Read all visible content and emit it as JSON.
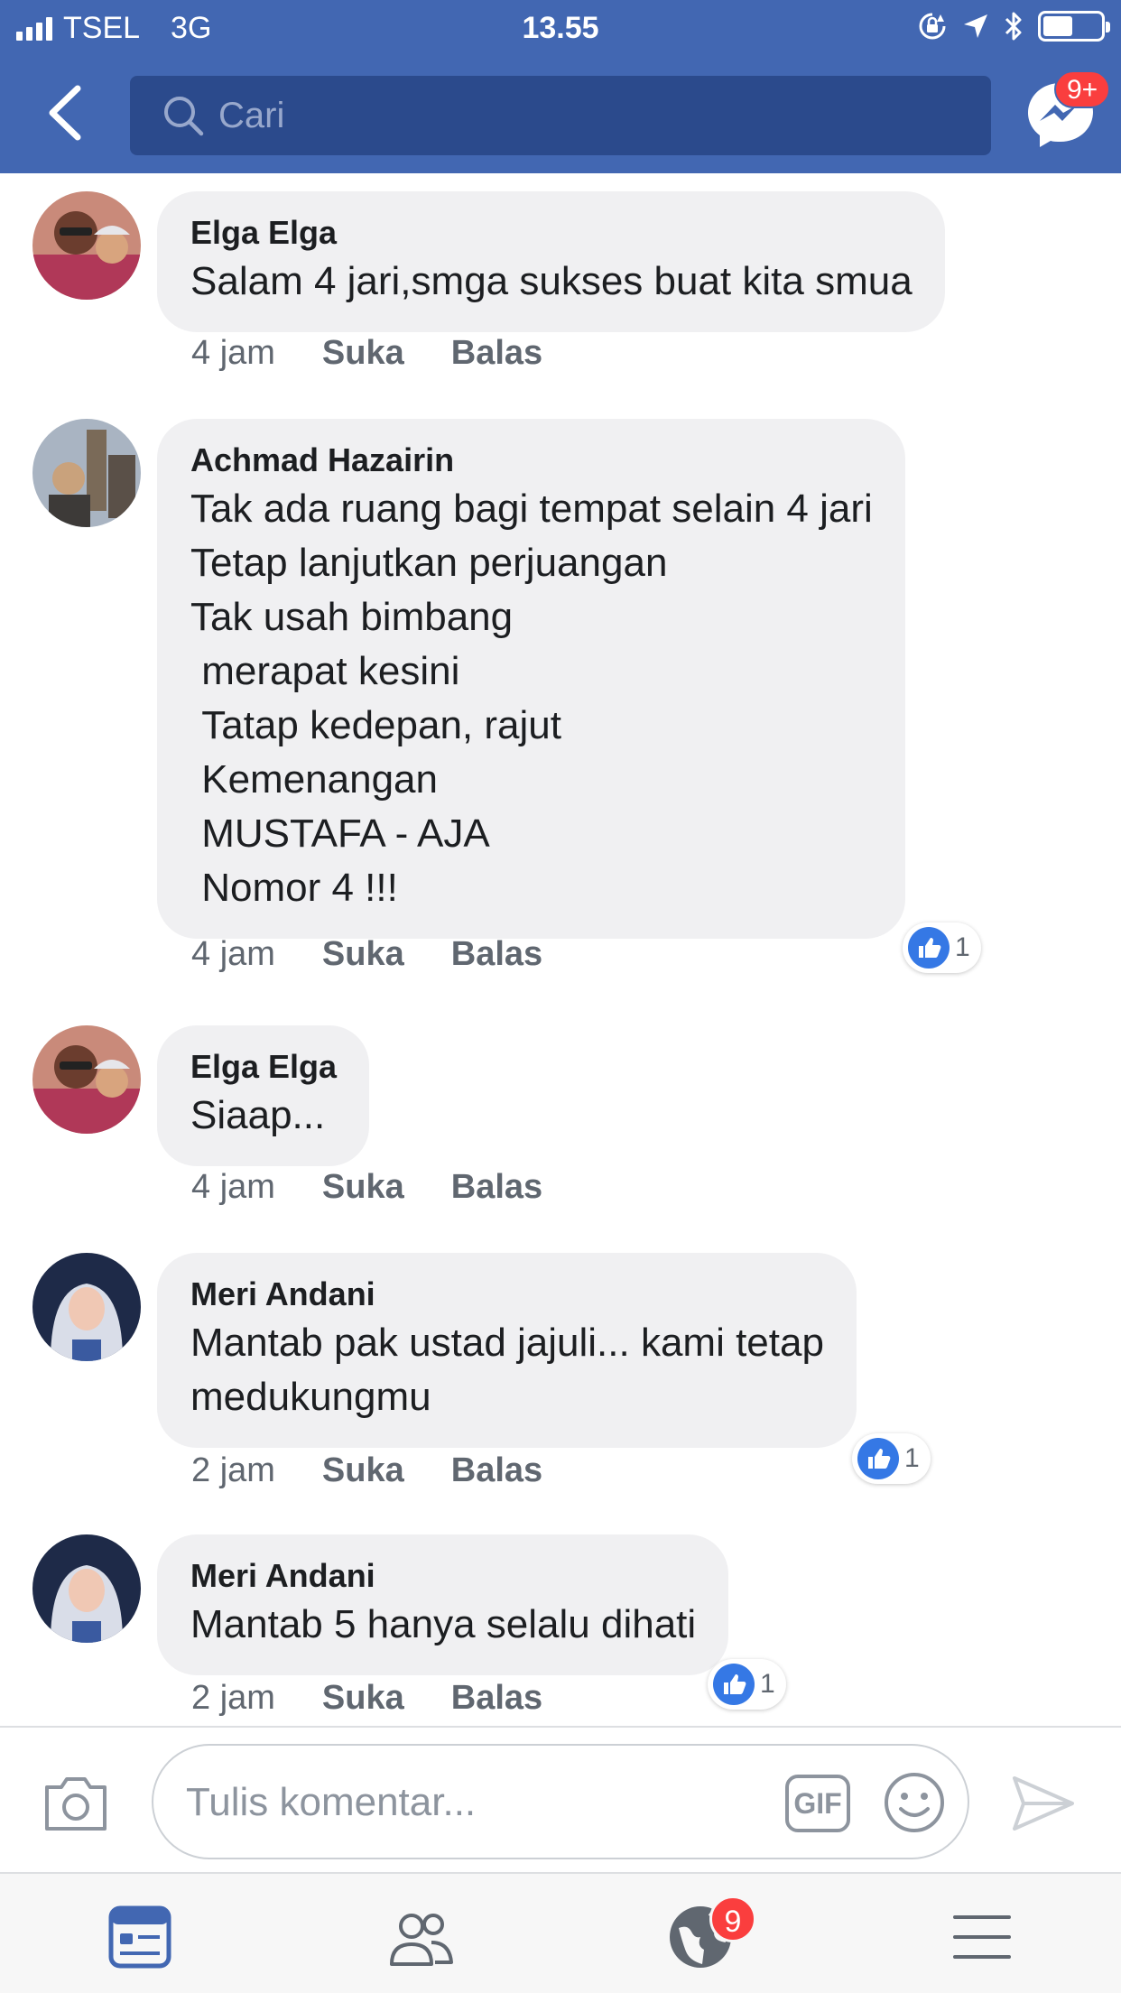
{
  "status_bar": {
    "carrier": "TSEL",
    "network": "3G",
    "time": "13.55"
  },
  "header": {
    "search_placeholder": "Cari",
    "messenger_badge": "9+"
  },
  "comments": [
    {
      "author": "Elga Elga",
      "text": "Salam 4 jari,smga sukses buat kita smua",
      "time": "4 jam",
      "like_label": "Suka",
      "reply_label": "Balas",
      "likes": null
    },
    {
      "author": "Achmad Hazairin",
      "text": "Tak ada ruang bagi tempat selain 4 jari\nTetap lanjutkan perjuangan\nTak usah bimbang\n merapat kesini\n Tatap kedepan, rajut\n Kemenangan\n MUSTAFA - AJA\n Nomor 4 !!!",
      "time": "4 jam",
      "like_label": "Suka",
      "reply_label": "Balas",
      "likes": "1"
    },
    {
      "author": "Elga Elga",
      "text": "Siaap...",
      "time": "4 jam",
      "like_label": "Suka",
      "reply_label": "Balas",
      "likes": null
    },
    {
      "author": "Meri Andani",
      "text": "Mantab pak ustad jajuli... kami tetap\nmedukungmu",
      "time": "2 jam",
      "like_label": "Suka",
      "reply_label": "Balas",
      "likes": "1"
    },
    {
      "author": "Meri Andani",
      "text": "Mantab 5 hanya selalu dihati",
      "time": "2 jam",
      "like_label": "Suka",
      "reply_label": "Balas",
      "likes": "1"
    }
  ],
  "composer": {
    "placeholder": "Tulis komentar...",
    "gif_label": "GIF"
  },
  "tabbar": {
    "notifications_badge": "9"
  },
  "colors": {
    "brand": "#4267b2",
    "like_blue": "#3578e5",
    "badge_red": "#fa3e3e"
  }
}
